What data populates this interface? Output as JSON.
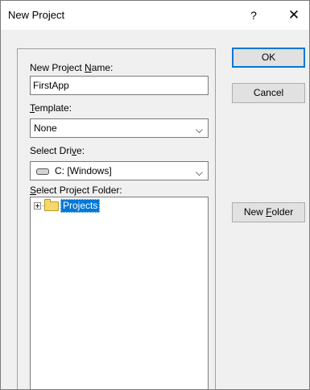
{
  "window": {
    "title": "New Project",
    "help": "?",
    "close": "✕"
  },
  "form": {
    "name_label_pre": "New Project ",
    "name_label_key": "N",
    "name_label_post": "ame:",
    "name_value": "FirstApp",
    "template_label_key": "T",
    "template_label_post": "emplate:",
    "template_value": "None",
    "drive_label_pre": "Select Dri",
    "drive_label_key": "v",
    "drive_label_post": "e:",
    "drive_value": "C: [Windows]",
    "folder_label_key": "S",
    "folder_label_post": "elect Project Folder:",
    "folder_item": "Projects",
    "chevron": "⌵"
  },
  "buttons": {
    "ok": "OK",
    "cancel": "Cancel",
    "new_folder_pre": "New ",
    "new_folder_key": "F",
    "new_folder_post": "older"
  }
}
